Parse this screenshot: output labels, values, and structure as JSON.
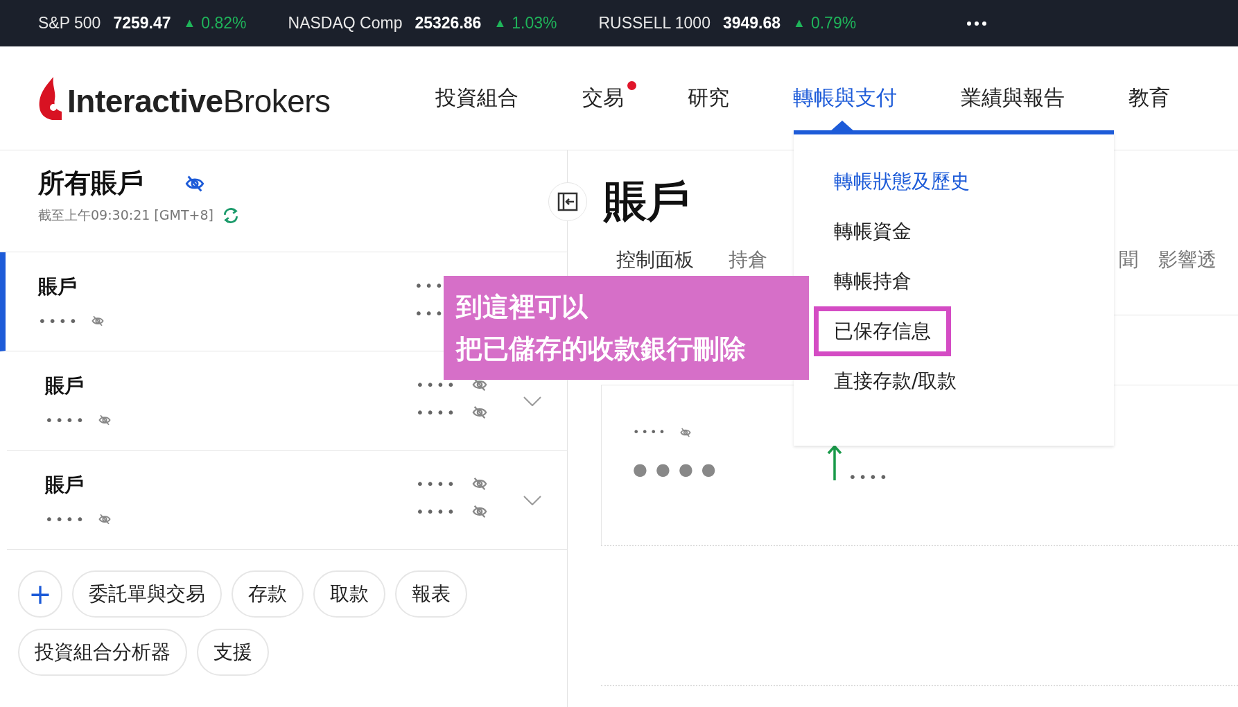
{
  "ticker": [
    {
      "name": "S&P 500",
      "value": "7259.47",
      "arrow": "▲",
      "change": "0.82%"
    },
    {
      "name": "NASDAQ Comp",
      "value": "25326.86",
      "arrow": "▲",
      "change": "1.03%"
    },
    {
      "name": "RUSSELL 1000",
      "value": "3949.68",
      "arrow": "▲",
      "change": "0.79%"
    }
  ],
  "logo": "**Interactive**Brokers",
  "nav": [
    {
      "label": "投資組合",
      "selected": false,
      "badge": false
    },
    {
      "label": "交易",
      "selected": false,
      "badge": true
    },
    {
      "label": "研究",
      "selected": false,
      "badge": false
    },
    {
      "label": "轉帳與支付",
      "selected": true,
      "badge": false
    },
    {
      "label": "業績與報告",
      "selected": false,
      "badge": false
    },
    {
      "label": "教育",
      "selected": false,
      "badge": false
    }
  ],
  "sidebar": {
    "title": "所有賬戶",
    "timestamp": "截至上午09:30:21 [GMT+8]",
    "accounts": [
      {
        "name": "賬戶",
        "masked": "••••",
        "values": [
          "•••",
          "•••"
        ],
        "selected": true
      },
      {
        "name": "賬戶",
        "masked": "••••",
        "values": [
          "••••",
          "••••"
        ],
        "selected": false
      },
      {
        "name": "賬戶",
        "masked": "••••",
        "values": [
          "••••",
          "••••"
        ],
        "selected": false
      }
    ],
    "actions": [
      {
        "kind": "icon",
        "label": "+"
      },
      {
        "kind": "text",
        "label": "委託單與交易"
      },
      {
        "kind": "text",
        "label": "存款"
      },
      {
        "kind": "text",
        "label": "取款"
      },
      {
        "kind": "text",
        "label": "報表"
      },
      {
        "kind": "text",
        "label": "投資組合分析器"
      },
      {
        "kind": "text",
        "label": "支援"
      }
    ]
  },
  "main": {
    "title": "賬戶",
    "tabs": [
      {
        "label": "控制面板",
        "selected": false
      },
      {
        "label": "持倉",
        "selected": false
      },
      {
        "label": "聞",
        "selected": false
      },
      {
        "label": "影響透",
        "selected": false
      }
    ],
    "card": {
      "label": "••••",
      "value": "●●●●",
      "change": "••••"
    }
  },
  "dropdown": [
    {
      "label": "轉帳狀態及歷史",
      "selected": true,
      "highlighted": false
    },
    {
      "label": "轉帳資金",
      "selected": false,
      "highlighted": false
    },
    {
      "label": "轉帳持倉",
      "selected": false,
      "highlighted": false
    },
    {
      "label": "已保存信息",
      "selected": false,
      "highlighted": true
    },
    {
      "label": "直接存款/取款",
      "selected": false,
      "highlighted": false
    }
  ],
  "callout": [
    "到這裡可以",
    "把已儲存的收款銀行刪除"
  ]
}
